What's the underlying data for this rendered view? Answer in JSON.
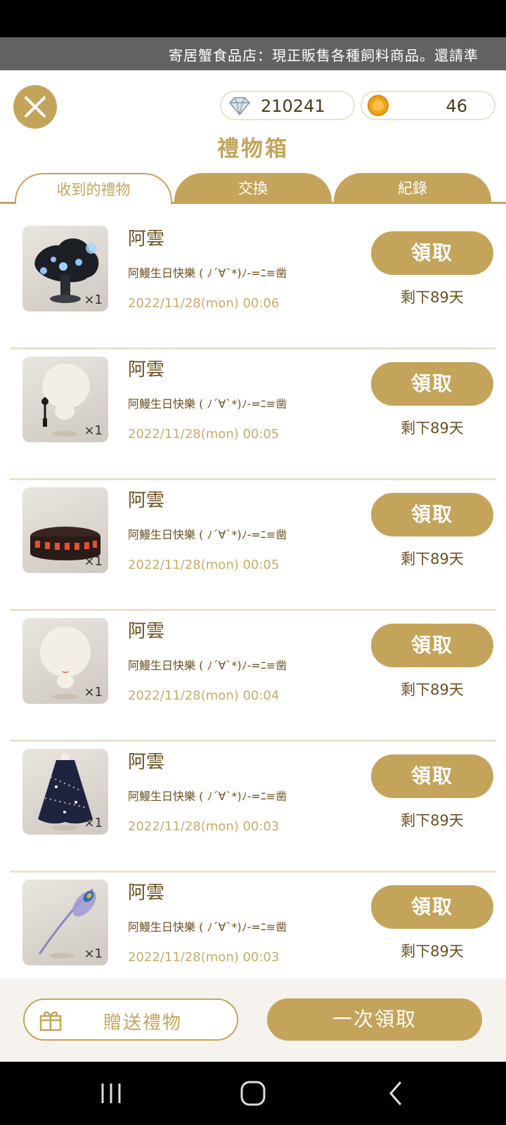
{
  "ticker": {
    "text": "寄居蟹食品店：現正販售各種飼料商品。還請準"
  },
  "currency": {
    "diamonds": "210241",
    "coins": "46"
  },
  "title": "禮物箱",
  "tabs": [
    {
      "label": "收到的禮物",
      "active": true
    },
    {
      "label": "交換",
      "active": false
    },
    {
      "label": "紀錄",
      "active": false
    }
  ],
  "gifts": [
    {
      "item": "glowing-tree",
      "qty": "×1",
      "sender": "阿雲",
      "message": "阿鰻生日快樂 ( ﾉ´∀`*)ﾉ-=ﾆ≡凿",
      "date": "2022/11/28(mon) 00:06",
      "claim": "領取",
      "remaining": "剩下89天"
    },
    {
      "item": "white-hair-tassel",
      "qty": "×1",
      "sender": "阿雲",
      "message": "阿鰻生日快樂 ( ﾉ´∀`*)ﾉ-=ﾆ≡凿",
      "date": "2022/11/28(mon) 00:05",
      "claim": "領取",
      "remaining": "剩下89天"
    },
    {
      "item": "round-lantern-wall",
      "qty": "×1",
      "sender": "阿雲",
      "message": "阿鰻生日快樂 ( ﾉ´∀`*)ﾉ-=ﾆ≡凿",
      "date": "2022/11/28(mon) 00:05",
      "claim": "領取",
      "remaining": "剩下89天"
    },
    {
      "item": "white-hair-face",
      "qty": "×1",
      "sender": "阿雲",
      "message": "阿鰻生日快樂 ( ﾉ´∀`*)ﾉ-=ﾆ≡凿",
      "date": "2022/11/28(mon) 00:04",
      "claim": "領取",
      "remaining": "剩下89天"
    },
    {
      "item": "starry-cloak",
      "qty": "×1",
      "sender": "阿雲",
      "message": "阿鰻生日快樂 ( ﾉ´∀`*)ﾉ-=ﾆ≡凿",
      "date": "2022/11/28(mon) 00:03",
      "claim": "領取",
      "remaining": "剩下89天"
    },
    {
      "item": "peacock-feather",
      "qty": "×1",
      "sender": "阿雲",
      "message": "阿鰻生日快樂 ( ﾉ´∀`*)ﾉ-=ﾆ≡凿",
      "date": "2022/11/28(mon) 00:03",
      "claim": "領取",
      "remaining": "剩下89天"
    }
  ],
  "footer": {
    "send_gift": "贈送禮物",
    "claim_all": "一次領取"
  },
  "colors": {
    "accent": "#c4a45a",
    "text": "#6b5020",
    "date": "#c9aa68"
  },
  "icons": {
    "close": "close-icon",
    "diamond": "diamond-icon",
    "coin": "coin-icon",
    "gift": "gift-icon"
  }
}
